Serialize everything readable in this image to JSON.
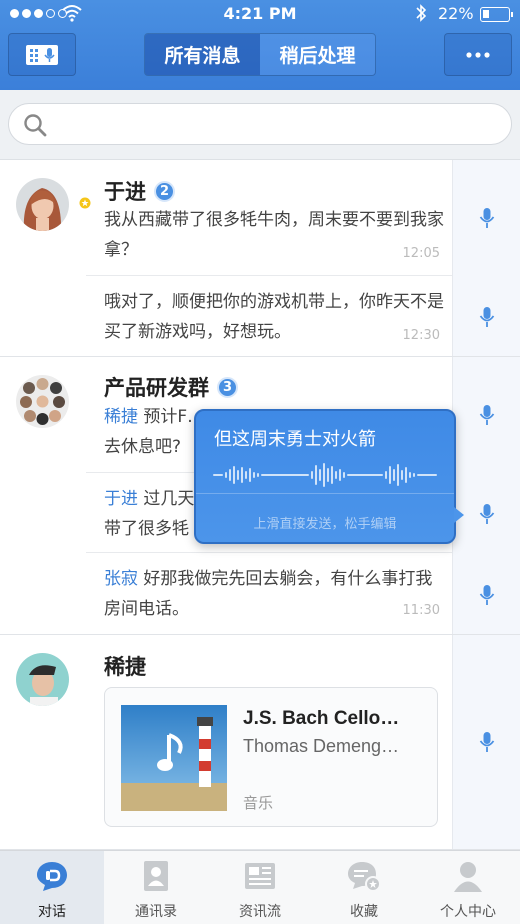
{
  "status_bar": {
    "time": "4:21 PM",
    "battery": "22%"
  },
  "header": {
    "tabs": [
      "所有消息",
      "稍后处理"
    ],
    "active_tab": 0
  },
  "search": {
    "placeholder": ""
  },
  "conversations": [
    {
      "name": "于进",
      "badge": "2",
      "avatar": "woman-portrait",
      "messages": [
        {
          "text": "我从西藏带了很多牦牛肉，周末要不要到我家拿？",
          "time": "12:05"
        },
        {
          "text": "哦对了，顺便把你的游戏机带上，你昨天不是买了新游戏吗，好想玩。",
          "time": "12:30"
        }
      ]
    },
    {
      "name": "产品研发群",
      "badge": "3",
      "avatar": "group-grid",
      "messages": [
        {
          "sender": "稀捷",
          "text": "预计F…去休息吧?",
          "time": ""
        },
        {
          "sender": "于进",
          "text": "过几天…带了很多牦",
          "time": ""
        },
        {
          "sender": "张寂",
          "text": "好那我做完先回去躺会，有什么事打我房间电话。",
          "time": "11:30"
        }
      ]
    },
    {
      "name": "稀捷",
      "avatar": "man-portrait",
      "card": {
        "title": "J.S. Bach Cello…",
        "subtitle": "Thomas Demeng…",
        "category": "音乐"
      }
    }
  ],
  "voice_popup": {
    "text": "但这周末勇士对火箭",
    "hint": "上滑直接发送，松手编辑"
  },
  "tabbar": {
    "items": [
      {
        "label": "对话",
        "icon": "chat-icon"
      },
      {
        "label": "通讯录",
        "icon": "contacts-icon"
      },
      {
        "label": "资讯流",
        "icon": "news-icon"
      },
      {
        "label": "收藏",
        "icon": "favorites-icon"
      },
      {
        "label": "个人中心",
        "icon": "profile-icon"
      }
    ],
    "active": 0
  },
  "colors": {
    "accent": "#4a90e2",
    "name_link": "#3a7fd6"
  }
}
